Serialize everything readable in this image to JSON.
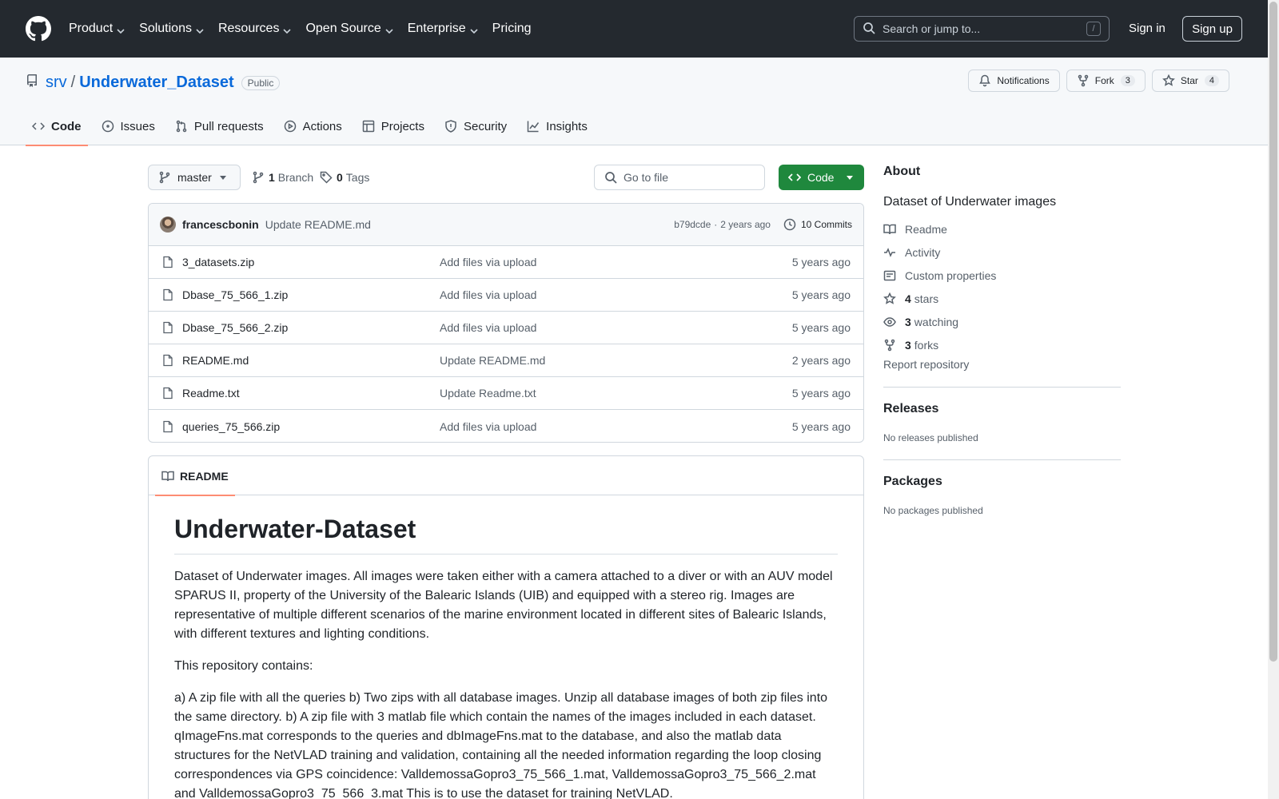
{
  "header": {
    "nav": [
      "Product",
      "Solutions",
      "Resources",
      "Open Source",
      "Enterprise",
      "Pricing"
    ],
    "search_placeholder": "Search or jump to...",
    "search_key": "/",
    "signin": "Sign in",
    "signup": "Sign up"
  },
  "repo": {
    "owner": "srv",
    "separator": "/",
    "name": "Underwater_Dataset",
    "visibility": "Public",
    "notifications_label": "Notifications",
    "fork_label": "Fork",
    "fork_count": "3",
    "star_label": "Star",
    "star_count": "4",
    "tabs": [
      "Code",
      "Issues",
      "Pull requests",
      "Actions",
      "Projects",
      "Security",
      "Insights"
    ]
  },
  "toolbar": {
    "branch": "master",
    "branch_count": "1",
    "branch_label": "Branch",
    "tag_count": "0",
    "tag_label": "Tags",
    "goto_placeholder": "Go to file",
    "code_label": "Code"
  },
  "latest_commit": {
    "author": "francescbonin",
    "message": "Update README.md",
    "sha": "b79dcde",
    "dot": "·",
    "age": "2 years ago",
    "commits": "10 Commits"
  },
  "files": [
    {
      "name": "3_datasets.zip",
      "commit": "Add files via upload",
      "age": "5 years ago"
    },
    {
      "name": "Dbase_75_566_1.zip",
      "commit": "Add files via upload",
      "age": "5 years ago"
    },
    {
      "name": "Dbase_75_566_2.zip",
      "commit": "Add files via upload",
      "age": "5 years ago"
    },
    {
      "name": "README.md",
      "commit": "Update README.md",
      "age": "2 years ago"
    },
    {
      "name": "Readme.txt",
      "commit": "Update Readme.txt",
      "age": "5 years ago"
    },
    {
      "name": "queries_75_566.zip",
      "commit": "Add files via upload",
      "age": "5 years ago"
    }
  ],
  "readme": {
    "tab": "README",
    "title": "Underwater-Dataset",
    "paragraphs": [
      "Dataset of Underwater images. All images were taken either with a camera attached to a diver or with an AUV model SPARUS II, property of the University of the Balearic Islands (UIB) and equipped with a stereo rig. Images are representative of multiple different scenarios of the marine environment located in different sites of Balearic Islands, with different textures and lighting conditions.",
      "This repository contains:",
      "a) A zip file with all the queries b) Two zips with all database images. Unzip all database images of both zip files into the same directory. b) A zip file with 3 matlab file which contain the names of the images included in each dataset. qImageFns.mat corresponds to the queries and dbImageFns.mat to the database, and also the matlab data structures for the NetVLAD training and validation, containing all the needed information regarding the loop closing correspondences via GPS coincidence: ValldemossaGopro3_75_566_1.mat, ValldemossaGopro3_75_566_2.mat and ValldemossaGopro3_75_566_3.mat This is to use the dataset for training NetVLAD."
    ]
  },
  "sidebar": {
    "about_title": "About",
    "description": "Dataset of Underwater images",
    "readme": "Readme",
    "activity": "Activity",
    "custom_properties": "Custom properties",
    "stars_count": "4",
    "stars_label": "stars",
    "watching_count": "3",
    "watching_label": "watching",
    "forks_count": "3",
    "forks_label": "forks",
    "report": "Report repository",
    "releases_title": "Releases",
    "releases_text": "No releases published",
    "packages_title": "Packages",
    "packages_text": "No packages published"
  }
}
